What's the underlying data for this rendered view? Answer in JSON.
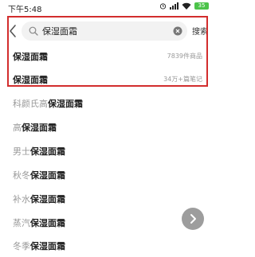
{
  "status_bar": {
    "time": "下午5:48",
    "battery": "35"
  },
  "search": {
    "query": "保湿面霜",
    "button_label": "搜索"
  },
  "suggestions": [
    {
      "title": "保湿面霜",
      "meta": "7839件商品"
    },
    {
      "title": "保湿面霜",
      "meta": "34万+篇笔记"
    }
  ],
  "related": [
    {
      "prefix": "科颜氏高",
      "keyword": "保湿面霜"
    },
    {
      "prefix": "高",
      "keyword": "保湿面霜"
    },
    {
      "prefix": "男士",
      "keyword": "保湿面霜"
    },
    {
      "prefix": "秋冬",
      "keyword": "保湿面霜"
    },
    {
      "prefix": "补水",
      "keyword": "保湿面霜"
    },
    {
      "prefix": "蒸汽",
      "keyword": "保湿面霜"
    },
    {
      "prefix": "冬季",
      "keyword": "保湿面霜"
    }
  ],
  "colors": {
    "highlight": "#d22d2d",
    "battery": "#4cc34a",
    "search_bg": "#f2f2f2"
  },
  "icons": [
    "back-arrow-icon",
    "search-icon",
    "clear-icon",
    "chevron-right-icon",
    "signal-icon",
    "wifi-icon",
    "alarm-icon",
    "battery-icon"
  ]
}
